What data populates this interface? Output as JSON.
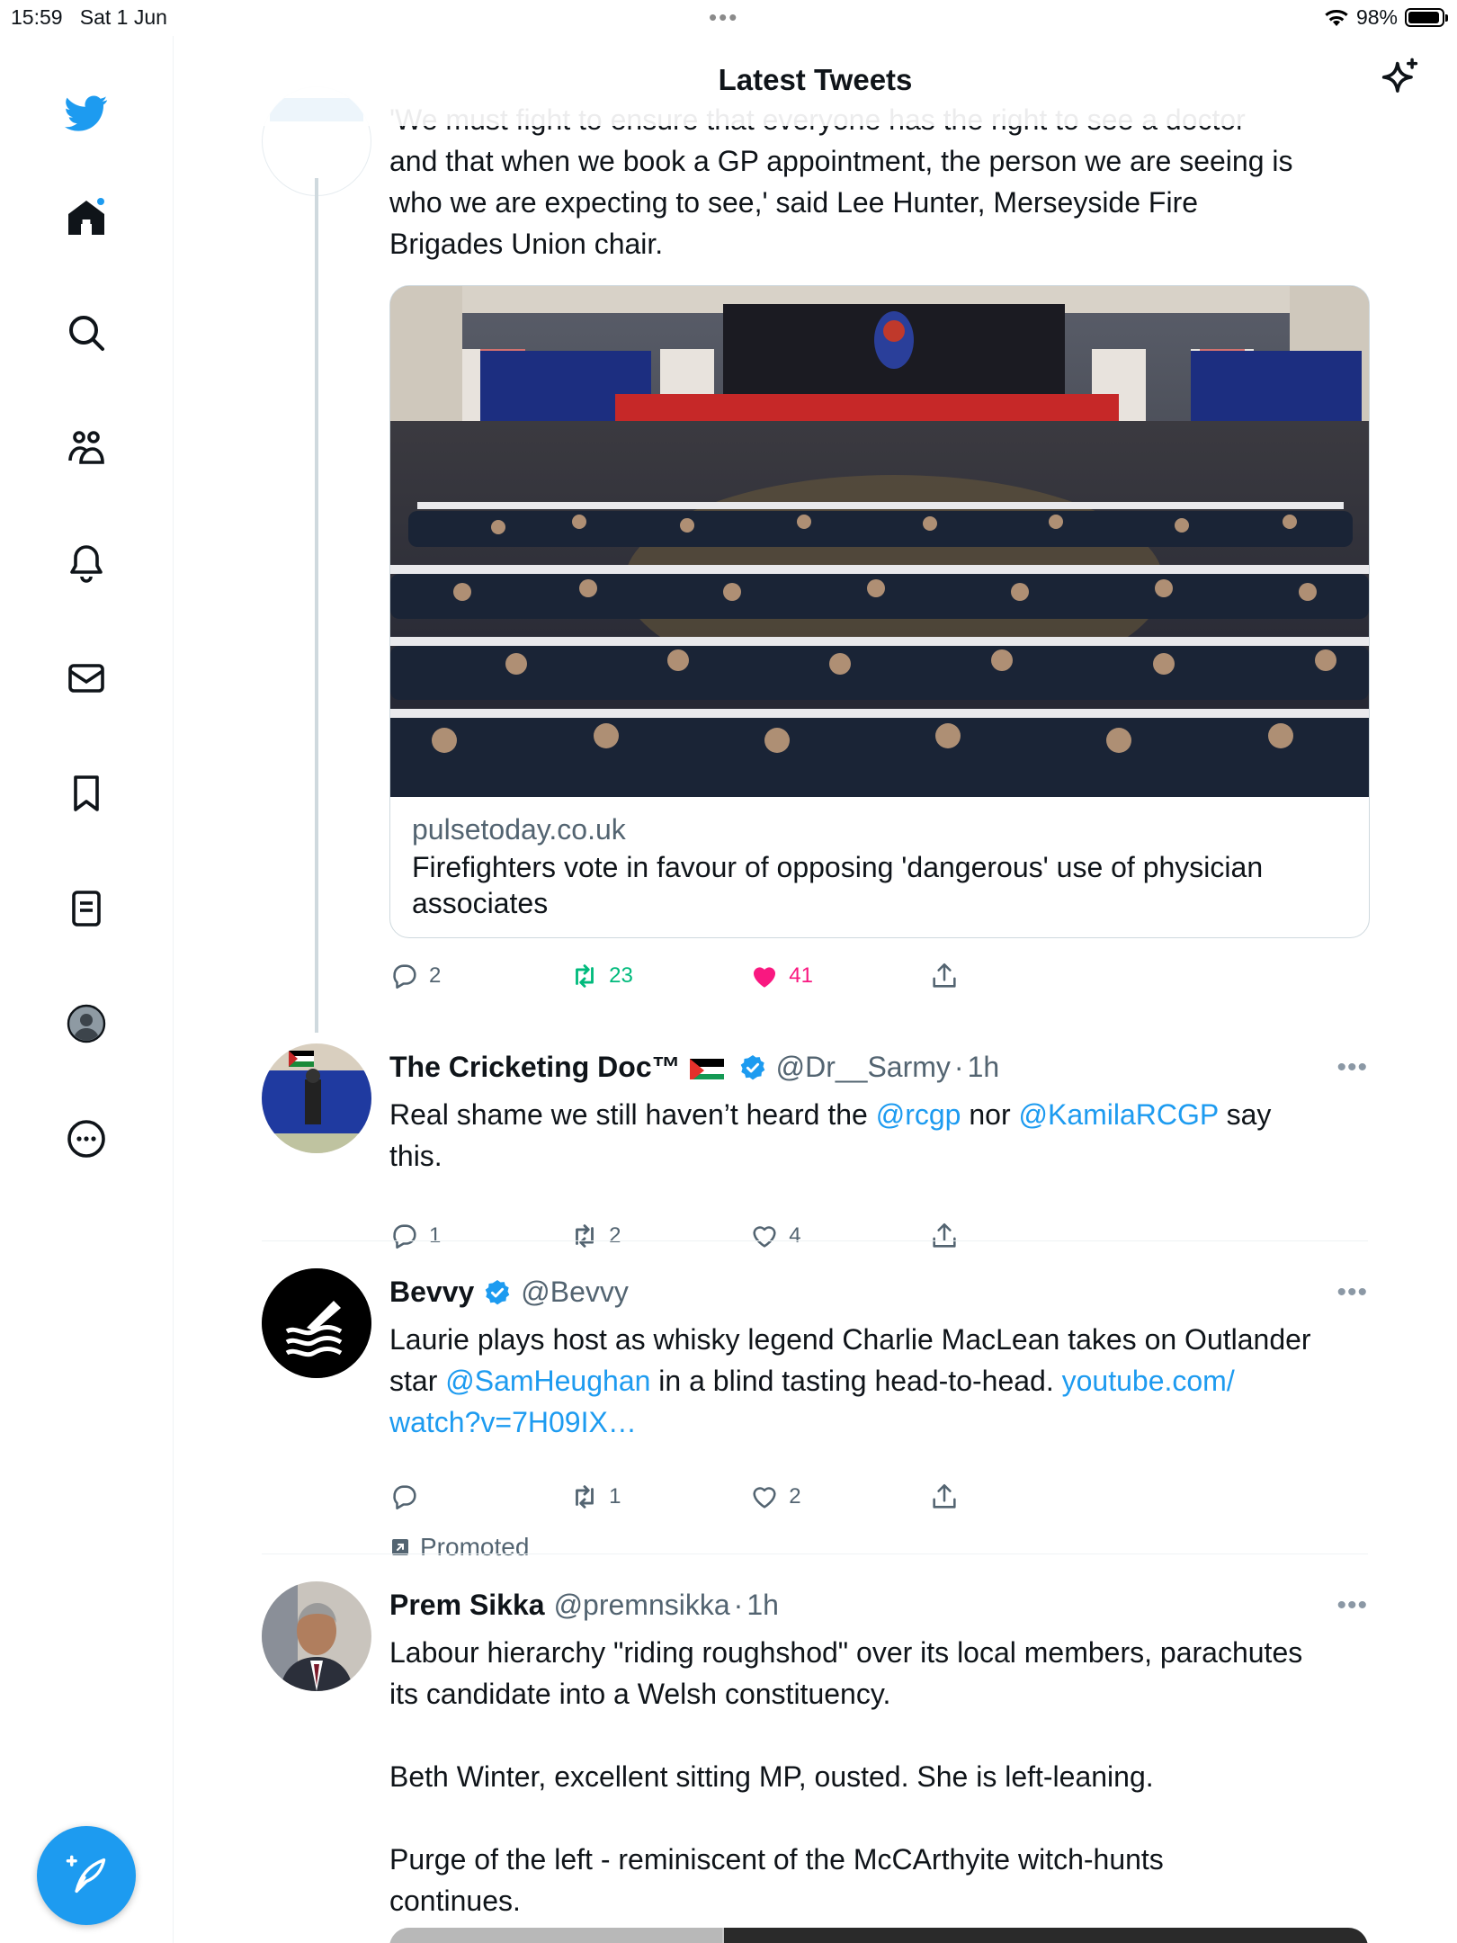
{
  "status_bar": {
    "time": "15:59",
    "date": "Sat 1 Jun",
    "dots": "•••",
    "battery": "98%"
  },
  "header": {
    "title": "Latest Tweets"
  },
  "sidebar": {
    "items": [
      {
        "name": "home"
      },
      {
        "name": "search"
      },
      {
        "name": "communities"
      },
      {
        "name": "notifications"
      },
      {
        "name": "messages"
      },
      {
        "name": "bookmarks"
      },
      {
        "name": "lists"
      },
      {
        "name": "profile"
      },
      {
        "name": "more"
      }
    ]
  },
  "tweets": [
    {
      "text_lines": [
        "'We must fight to ensure that everyone has the right to see a doctor",
        "and that when we book a GP appointment, the person we are seeing is",
        "who we are expecting to see,' said Lee Hunter, Merseyside Fire",
        "Brigades Union chair."
      ],
      "card": {
        "domain": "pulsetoday.co.uk",
        "title": "Firefighters vote in favour of opposing 'dangerous' use of physician associates"
      },
      "replies": "2",
      "retweets": "23",
      "likes": "41"
    },
    {
      "name": "The Cricketing Doc™",
      "handle": "@Dr__Sarmy",
      "sep": "·",
      "time": "1h",
      "text_a": "Real shame we still haven’t heard the ",
      "mention1": "@rcgp",
      "text_b": " nor ",
      "mention2": "@KamilaRCGP",
      "text_c": " say",
      "text_d": "this.",
      "replies": "1",
      "retweets": "2",
      "likes": "4"
    },
    {
      "name": "Bevvy",
      "handle": "@Bevvy",
      "text_a": "Laurie plays host as whisky legend Charlie MacLean takes on Outlander",
      "text_b": "star ",
      "mention": "@SamHeughan",
      "text_c": " in a blind tasting head-to-head. ",
      "link_a": "youtube.com/",
      "link_b": "watch?v=7H09IX…",
      "replies": "",
      "retweets": "1",
      "likes": "2",
      "promoted": "Promoted"
    },
    {
      "name": "Prem Sikka",
      "handle": "@premnsikka",
      "sep": "·",
      "time": "1h",
      "lines": [
        "Labour hierarchy \"riding roughshod\" over its local members, parachutes",
        "its candidate into a Welsh constituency.",
        "",
        "Beth Winter, excellent sitting MP, ousted. She is left-leaning.",
        "",
        "Purge of the left - reminiscent of the McCArthyite witch-hunts",
        "continues."
      ]
    }
  ],
  "colors": {
    "accent": "#1d9bf0",
    "retweet": "#00ba7c",
    "like": "#f91880",
    "text": "#0f1419",
    "muted": "#536471"
  },
  "icons": [
    "twitter-bird",
    "home",
    "search",
    "communities",
    "bell",
    "mail",
    "bookmark",
    "list",
    "profile",
    "more-circle",
    "sparkle",
    "reply",
    "retweet",
    "heart",
    "share",
    "verified",
    "promoted-arrow",
    "compose-feather"
  ]
}
